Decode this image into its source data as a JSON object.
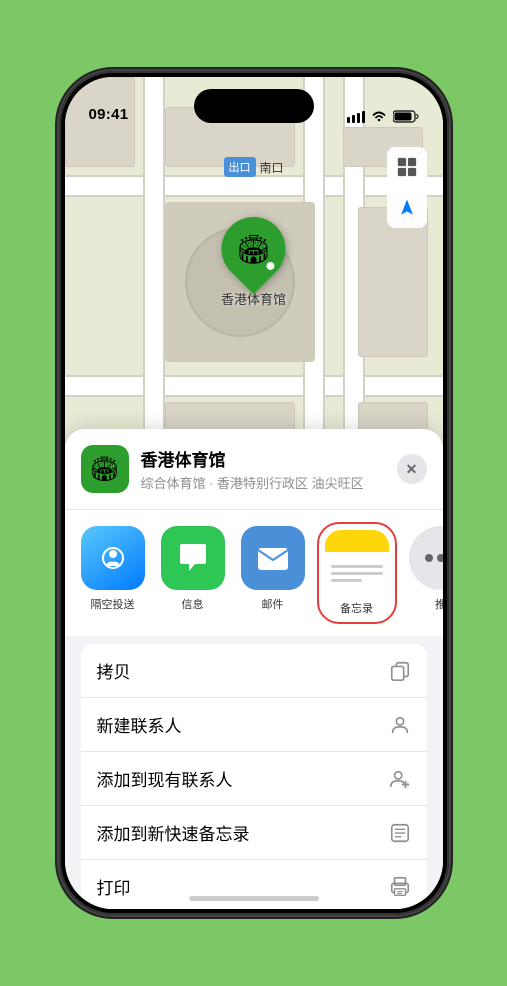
{
  "status": {
    "time": "09:41",
    "signal": "●●●",
    "wifi": "WiFi",
    "battery": "Battery"
  },
  "map": {
    "label_tag": "出口",
    "label_text": "南口",
    "pin_label": "香港体育馆",
    "controls": {
      "map_icon": "🗺",
      "location_icon": "➤"
    }
  },
  "location_card": {
    "name": "香港体育馆",
    "description": "综合体育馆 · 香港特别行政区 油尖旺区",
    "icon": "🏟",
    "close_label": "✕"
  },
  "share_items": [
    {
      "id": "airdrop",
      "label": "隔空投送",
      "type": "airdrop"
    },
    {
      "id": "message",
      "label": "信息",
      "type": "message"
    },
    {
      "id": "mail",
      "label": "邮件",
      "type": "mail"
    },
    {
      "id": "notes",
      "label": "备忘录",
      "type": "notes"
    },
    {
      "id": "more",
      "label": "推",
      "type": "more"
    }
  ],
  "actions": [
    {
      "id": "copy",
      "label": "拷贝",
      "icon": "⧉"
    },
    {
      "id": "new-contact",
      "label": "新建联系人",
      "icon": "👤"
    },
    {
      "id": "add-existing",
      "label": "添加到现有联系人",
      "icon": "👤+"
    },
    {
      "id": "quick-note",
      "label": "添加到新快速备忘录",
      "icon": "📋"
    },
    {
      "id": "print",
      "label": "打印",
      "icon": "🖨"
    }
  ]
}
